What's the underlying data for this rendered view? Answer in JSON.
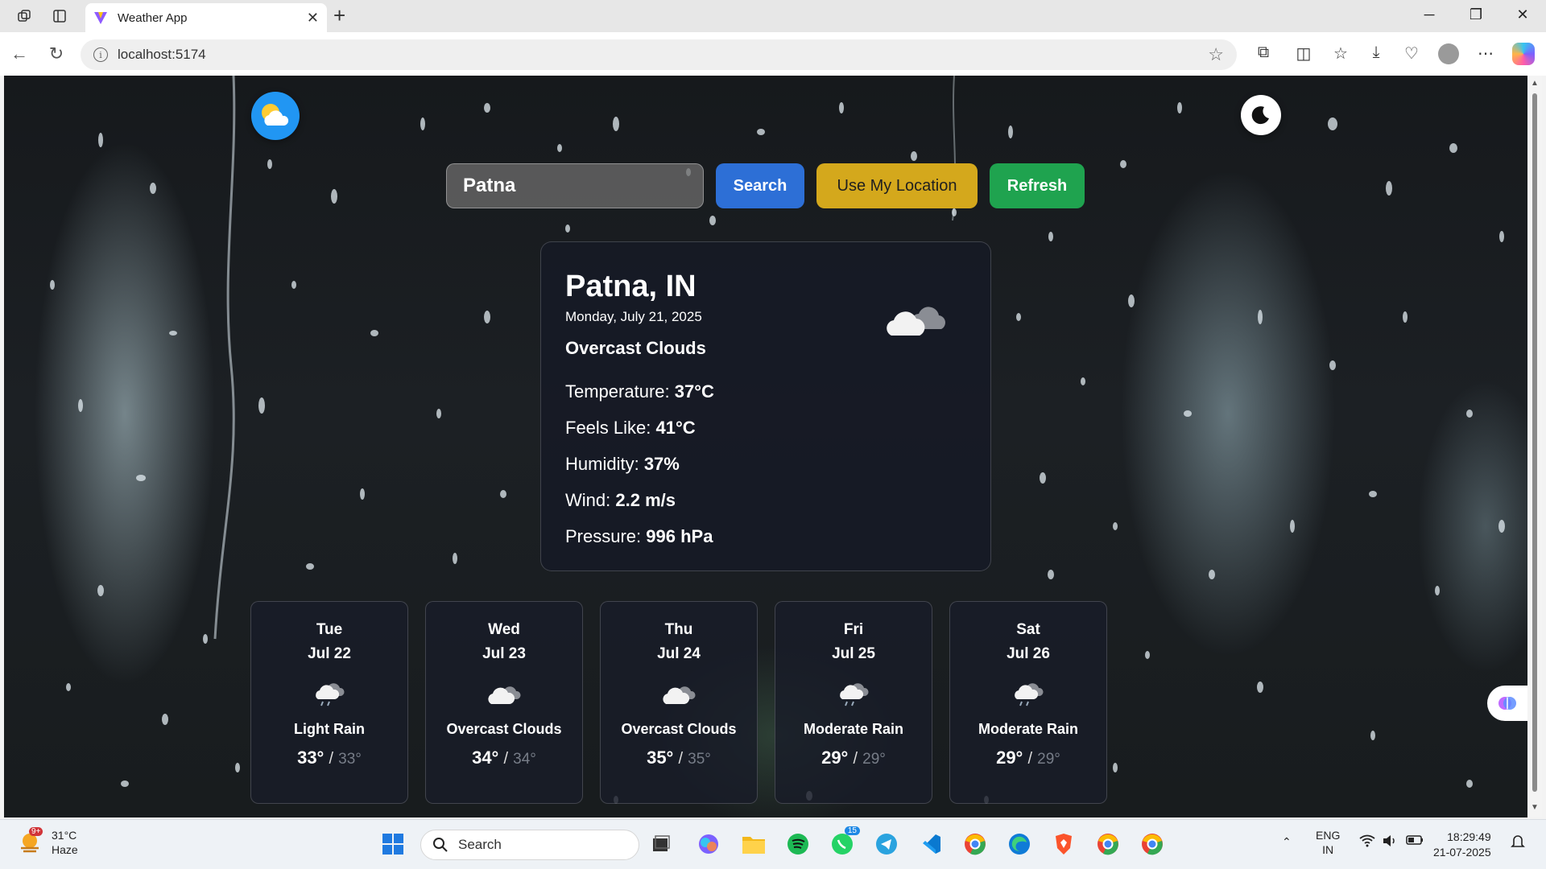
{
  "browser": {
    "tab_title": "Weather App",
    "url": "localhost:5174"
  },
  "app": {
    "search": {
      "value": "Patna",
      "placeholder": ""
    },
    "buttons": {
      "search": "Search",
      "use_location": "Use My Location",
      "refresh": "Refresh"
    },
    "current": {
      "city": "Patna, IN",
      "date": "Monday, July 21, 2025",
      "description": "Overcast Clouds",
      "stats": [
        {
          "label": "Temperature:",
          "value": "37°C"
        },
        {
          "label": "Feels Like:",
          "value": "41°C"
        },
        {
          "label": "Humidity:",
          "value": "37%"
        },
        {
          "label": "Wind:",
          "value": "2.2 m/s"
        },
        {
          "label": "Pressure:",
          "value": "996 hPa"
        }
      ],
      "icon": "cloud-icon"
    },
    "forecast": [
      {
        "day": "Tue",
        "date": "Jul 22",
        "description": "Light Rain",
        "max": "33°",
        "sep": "/",
        "min": "33°",
        "icon": "rain-cloud-icon"
      },
      {
        "day": "Wed",
        "date": "Jul 23",
        "description": "Overcast Clouds",
        "max": "34°",
        "sep": "/",
        "min": "34°",
        "icon": "cloud-icon"
      },
      {
        "day": "Thu",
        "date": "Jul 24",
        "description": "Overcast Clouds",
        "max": "35°",
        "sep": "/",
        "min": "35°",
        "icon": "cloud-icon"
      },
      {
        "day": "Fri",
        "date": "Jul 25",
        "description": "Moderate Rain",
        "max": "29°",
        "sep": "/",
        "min": "29°",
        "icon": "rain-cloud-icon"
      },
      {
        "day": "Sat",
        "date": "Jul 26",
        "description": "Moderate Rain",
        "max": "29°",
        "sep": "/",
        "min": "29°",
        "icon": "rain-cloud-icon"
      }
    ]
  },
  "taskbar": {
    "weather_temp": "31°C",
    "weather_desc": "Haze",
    "weather_badge": "9+",
    "search_label": "Search",
    "whatsapp_badge": "15",
    "lang_top": "ENG",
    "lang_bottom": "IN",
    "time": "18:29:49",
    "date": "21-07-2025"
  },
  "colors": {
    "search_button": "#2d6fd6",
    "location_button": "#d4a81c",
    "refresh_button": "#1fa34f",
    "card_bg": "#161a26"
  }
}
